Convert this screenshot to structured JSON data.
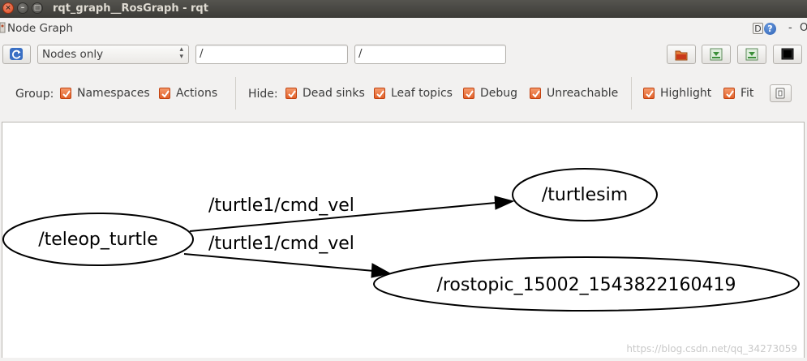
{
  "window": {
    "title": "rqt_graph__RosGraph - rqt",
    "controls": {
      "close": "×",
      "minimize": "–",
      "maximize": "□"
    }
  },
  "plugin": {
    "title": "Node Graph",
    "right_icons": {
      "d_label": "D",
      "help_label": "?",
      "dash_label": "-",
      "o_label": "O"
    }
  },
  "toolbar": {
    "mode_select": "Nodes only",
    "filter_1": "/",
    "filter_2": "/"
  },
  "options": {
    "group_label": "Group:",
    "namespaces": "Namespaces",
    "actions": "Actions",
    "hide_label": "Hide:",
    "dead_sinks": "Dead sinks",
    "leaf_topics": "Leaf topics",
    "debug": "Debug",
    "unreachable": "Unreachable",
    "highlight": "Highlight",
    "fit": "Fit"
  },
  "graph": {
    "nodes": {
      "teleop": "/teleop_turtle",
      "turtlesim": "/turtlesim",
      "rostopic": "/rostopic_15002_1543822160419"
    },
    "edges": {
      "to_turtlesim": "/turtle1/cmd_vel",
      "to_rostopic": "/turtle1/cmd_vel"
    }
  },
  "watermark": "https://blog.csdn.net/qq_34273059",
  "colors": {
    "checkbox": "#e2612a",
    "refresh_icon": "#3a6fc4"
  }
}
